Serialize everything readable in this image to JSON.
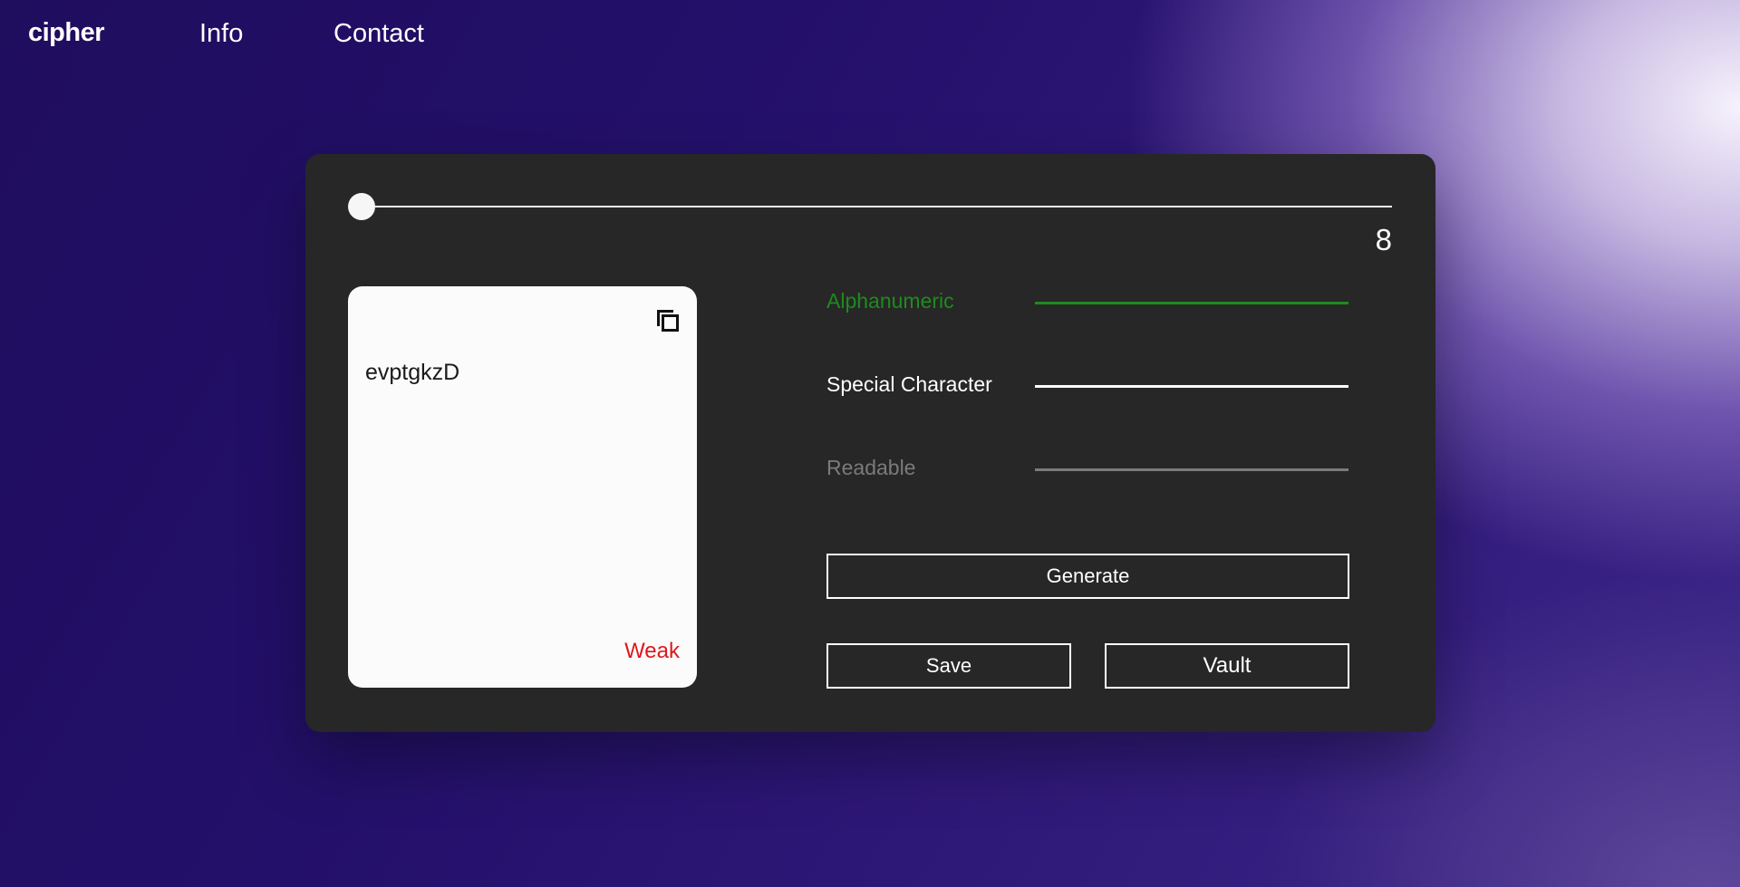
{
  "nav": {
    "brand": "cipher",
    "links": [
      {
        "label": "Info"
      },
      {
        "label": "Contact"
      }
    ]
  },
  "generator": {
    "length": "8",
    "length_fraction": 0.0,
    "password": "evptgkzD",
    "strength": "Weak",
    "copy_icon": "copy-icon",
    "options": [
      {
        "label": "Alphanumeric",
        "state": "active",
        "color": "#1f8a1f"
      },
      {
        "label": "Special Character",
        "state": "enabled",
        "color": "#ffffff"
      },
      {
        "label": "Readable",
        "state": "disabled",
        "color": "#7b7b7b"
      }
    ],
    "buttons": {
      "generate": "Generate",
      "save": "Save",
      "vault": "Vault"
    }
  },
  "colors": {
    "card_bg": "#272727",
    "panel_bg": "#fbfbfb",
    "strength_weak": "#e0181b",
    "accent_green": "#1f8a1f"
  }
}
